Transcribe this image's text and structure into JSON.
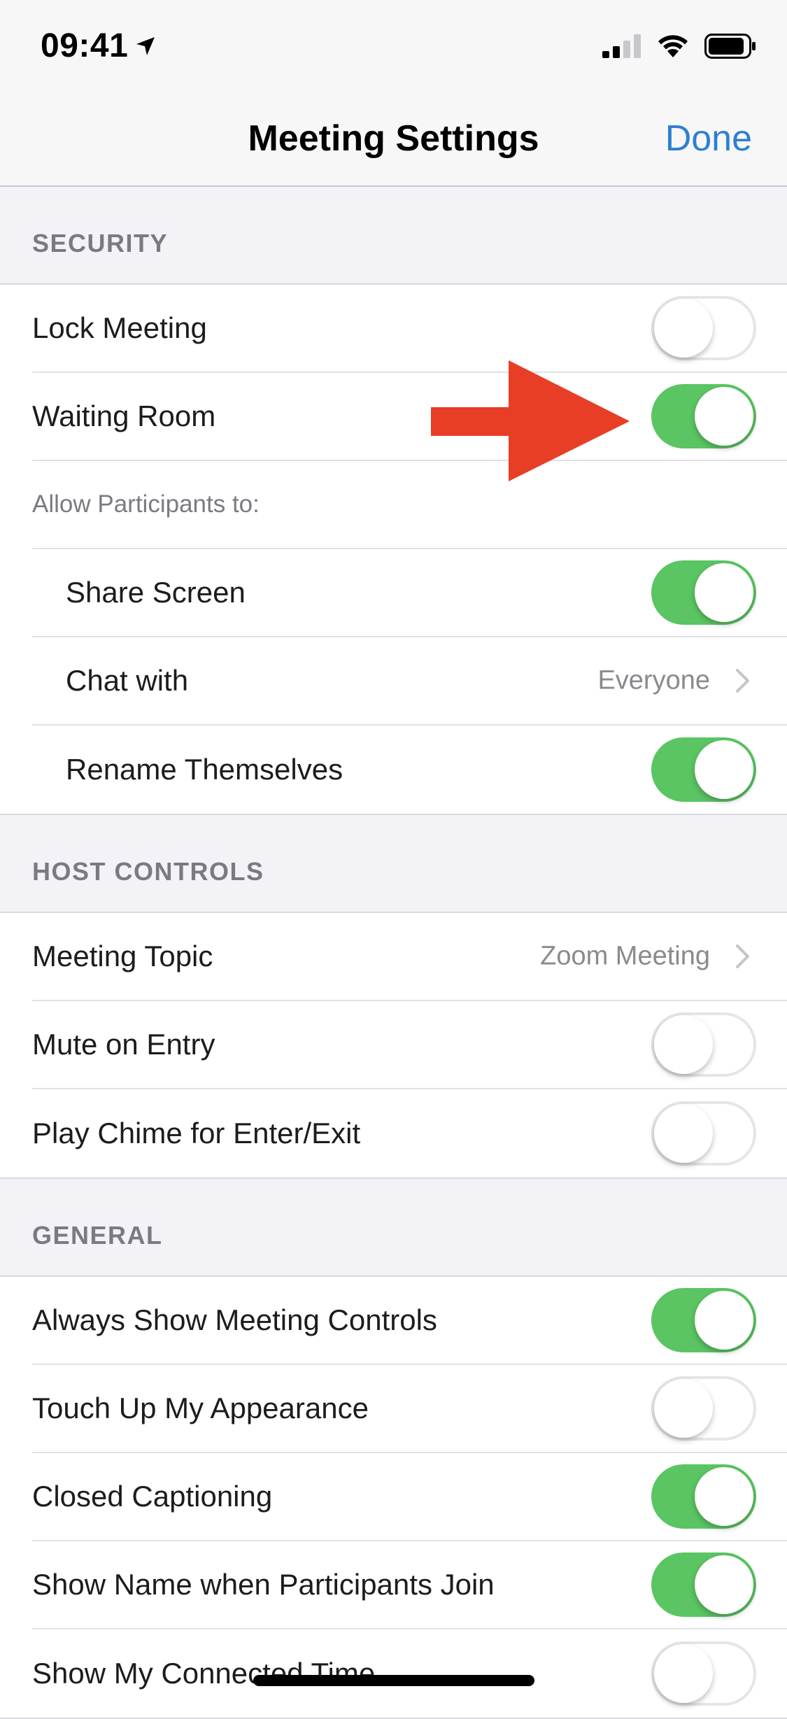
{
  "status_bar": {
    "time": "09:41",
    "location_icon": "location-arrow-icon",
    "signal_icon": "cellular-signal-icon",
    "wifi_icon": "wifi-icon",
    "battery_icon": "battery-icon"
  },
  "nav": {
    "title": "Meeting Settings",
    "done_label": "Done"
  },
  "sections": {
    "security": {
      "header": "SECURITY",
      "lock_meeting": {
        "label": "Lock Meeting",
        "on": false
      },
      "waiting_room": {
        "label": "Waiting Room",
        "on": true
      },
      "allow_label": "Allow Participants to:",
      "share_screen": {
        "label": "Share Screen",
        "on": true
      },
      "chat_with": {
        "label": "Chat with",
        "value": "Everyone"
      },
      "rename_themselves": {
        "label": "Rename Themselves",
        "on": true
      }
    },
    "host_controls": {
      "header": "HOST CONTROLS",
      "meeting_topic": {
        "label": "Meeting Topic",
        "value": "Zoom Meeting"
      },
      "mute_on_entry": {
        "label": "Mute on Entry",
        "on": false
      },
      "play_chime": {
        "label": "Play Chime for Enter/Exit",
        "on": false
      }
    },
    "general": {
      "header": "GENERAL",
      "always_show_controls": {
        "label": "Always Show Meeting Controls",
        "on": true
      },
      "touch_up": {
        "label": "Touch Up My Appearance",
        "on": false
      },
      "closed_captioning": {
        "label": "Closed Captioning",
        "on": true
      },
      "show_name_join": {
        "label": "Show Name when Participants Join",
        "on": true
      },
      "show_connected_time": {
        "label": "Show My Connected Time",
        "on": false
      }
    }
  },
  "colors": {
    "accent_blue": "#2d7fd3",
    "toggle_on_green": "#5ac562",
    "annotation_red": "#e83e26"
  },
  "annotation": {
    "icon": "red-arrow-annotation"
  }
}
